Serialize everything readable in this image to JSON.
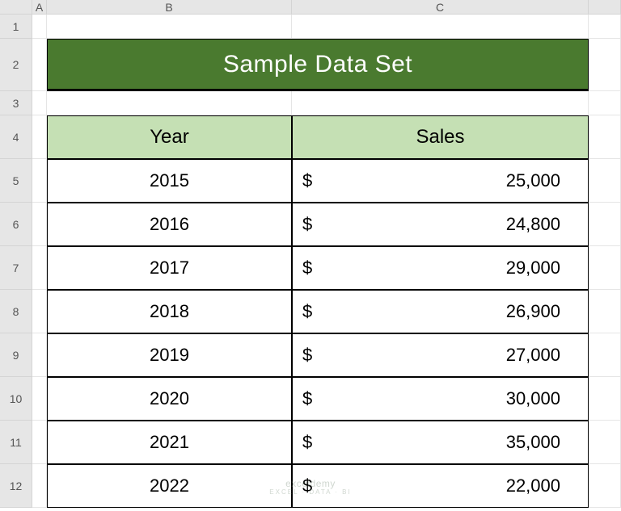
{
  "columns": {
    "corner": "",
    "A": "A",
    "B": "B",
    "C": "C"
  },
  "rows": [
    "1",
    "2",
    "3",
    "4",
    "5",
    "6",
    "7",
    "8",
    "9",
    "10",
    "11",
    "12"
  ],
  "title": "Sample Data Set",
  "table": {
    "headers": {
      "year": "Year",
      "sales": "Sales"
    },
    "rows": [
      {
        "year": "2015",
        "currency": "$",
        "sales": "25,000"
      },
      {
        "year": "2016",
        "currency": "$",
        "sales": "24,800"
      },
      {
        "year": "2017",
        "currency": "$",
        "sales": "29,000"
      },
      {
        "year": "2018",
        "currency": "$",
        "sales": "26,900"
      },
      {
        "year": "2019",
        "currency": "$",
        "sales": "27,000"
      },
      {
        "year": "2020",
        "currency": "$",
        "sales": "30,000"
      },
      {
        "year": "2021",
        "currency": "$",
        "sales": "35,000"
      },
      {
        "year": "2022",
        "currency": "$",
        "sales": "22,000"
      }
    ]
  },
  "watermark": {
    "main": "exceldemy",
    "sub": "EXCEL · DATA · BI"
  }
}
